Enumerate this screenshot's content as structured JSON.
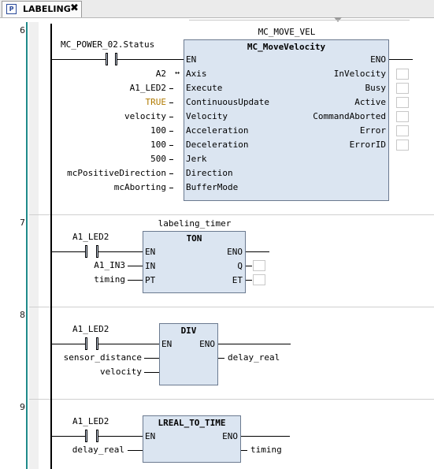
{
  "tab": {
    "label": "LABELING",
    "icon": "st-program-icon",
    "close": "✖"
  },
  "nets": [
    {
      "number": "6"
    },
    {
      "number": "7"
    },
    {
      "number": "8"
    },
    {
      "number": "9"
    }
  ],
  "net6": {
    "instance_name": "MC_MOVE_VEL",
    "fb_type": "MC_MoveVelocity",
    "contact_var": "MC_POWER_02.Status",
    "in_pins": [
      "EN",
      "Axis",
      "Execute",
      "ContinuousUpdate",
      "Velocity",
      "Acceleration",
      "Deceleration",
      "Jerk",
      "Direction",
      "BufferMode"
    ],
    "in_vals": [
      "",
      "A2",
      "A1_LED2",
      "TRUE",
      "velocity",
      "100",
      "100",
      "500",
      "mcPositiveDirection",
      "mcAborting"
    ],
    "out_pins": [
      "ENO",
      "InVelocity",
      "Busy",
      "Active",
      "CommandAborted",
      "Error",
      "ErrorID"
    ],
    "axis_link_symbol": "↔"
  },
  "net7": {
    "instance_name": "labeling_timer",
    "fb_type": "TON",
    "contact_var": "A1_LED2",
    "in_pins": [
      "EN",
      "IN",
      "PT"
    ],
    "in_vals": [
      "",
      "A1_IN3",
      "timing"
    ],
    "out_pins": [
      "ENO",
      "Q",
      "ET"
    ]
  },
  "net8": {
    "fb_type": "DIV",
    "contact_var": "A1_LED2",
    "in_pins": [
      "EN",
      "",
      ""
    ],
    "in_vals": [
      "",
      "sensor_distance",
      "velocity"
    ],
    "out_pins": [
      "ENO"
    ],
    "out_val": "delay_real"
  },
  "net9": {
    "fb_type": "LREAL_TO_TIME",
    "contact_var": "A1_LED2",
    "in_pins": [
      "EN"
    ],
    "in_vals": [
      "delay_real"
    ],
    "out_pins": [
      "ENO"
    ],
    "out_val": "timing"
  },
  "colors": {
    "block_fill": "#dbe5f1",
    "true_literal": "#b07a00",
    "gutter_line": "#1f8a8a"
  }
}
